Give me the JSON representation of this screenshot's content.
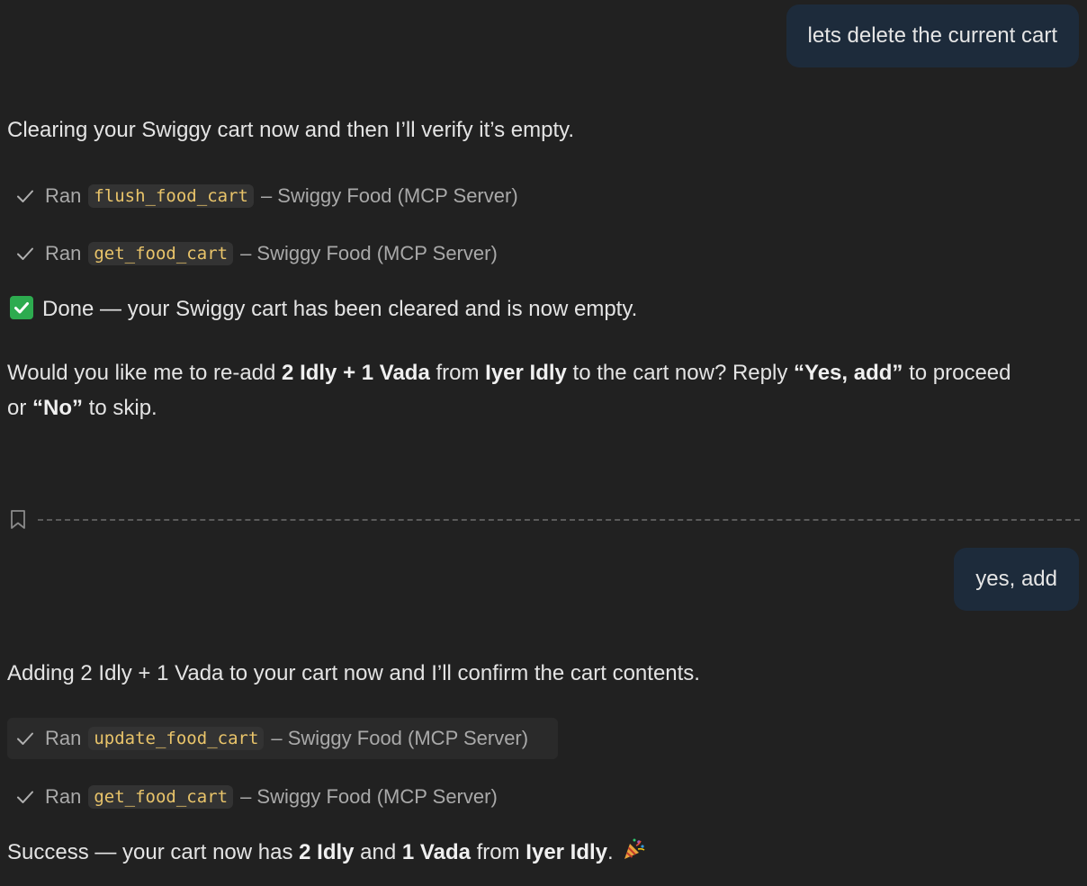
{
  "messages": {
    "user1": "lets delete the current cart",
    "assistant1_intro": "Clearing your Swiggy cart now and then I’ll verify it’s empty.",
    "tool_calls_1": [
      {
        "ran": "Ran",
        "tool": "flush_food_cart",
        "source": "– Swiggy Food (MCP Server)"
      },
      {
        "ran": "Ran",
        "tool": "get_food_cart",
        "source": "– Swiggy Food (MCP Server)"
      }
    ],
    "done_text": "Done — your Swiggy cart has been cleared and is now empty.",
    "question": {
      "p1": "Would you like me to re-add ",
      "b1": "2 Idly + 1 Vada",
      "p2": " from ",
      "b2": "Iyer Idly",
      "p3": " to the cart now? Reply ",
      "b3": "“Yes, add”",
      "p4": " to proceed or ",
      "b4": "“No”",
      "p5": " to skip."
    },
    "user2": "yes, add",
    "assistant2_intro": "Adding 2 Idly + 1 Vada to your cart now and I’ll confirm the cart contents.",
    "tool_calls_2": [
      {
        "ran": "Ran",
        "tool": "update_food_cart",
        "source": "– Swiggy Food (MCP Server)"
      },
      {
        "ran": "Ran",
        "tool": "get_food_cart",
        "source": "– Swiggy Food (MCP Server)"
      }
    ],
    "success": {
      "p1": "Success — your cart now has ",
      "b1": "2 Idly",
      "p2": " and ",
      "b2": "1 Vada",
      "p3": " from ",
      "b3": "Iyer Idly",
      "p4": "."
    }
  },
  "icons": {
    "check": "check-icon",
    "done": "white-check-mark-emoji",
    "bookmark": "bookmark-icon",
    "party": "party-popper-emoji"
  },
  "colors": {
    "background": "#212121",
    "user_bubble": "#1d2b3b",
    "code_text": "#e9c46a",
    "emoji_green": "#2dab4f"
  }
}
